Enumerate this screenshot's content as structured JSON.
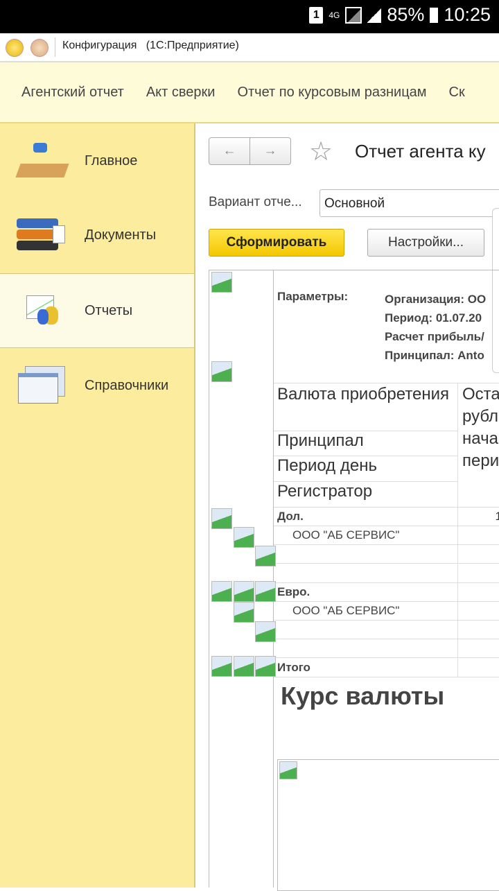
{
  "status_bar": {
    "sim": "1",
    "network": "4G",
    "battery": "85%",
    "time": "10:25"
  },
  "title_bar": {
    "title": "Конфигурация   (1С:Предприятие)"
  },
  "top_menu": [
    "Агентский отчет",
    "Акт сверки",
    "Отчет по курсовым разницам",
    "Ск"
  ],
  "sidebar": {
    "items": [
      {
        "label": "Главное"
      },
      {
        "label": "Документы"
      },
      {
        "label": "Отчеты"
      },
      {
        "label": "Справочники"
      }
    ]
  },
  "form": {
    "title": "Отчет агента ку",
    "variant_label": "Вариант отче...",
    "variant_value": "Основной",
    "generate": "Сформировать",
    "settings": "Настройки..."
  },
  "report": {
    "params_label": "Параметры:",
    "params": [
      "Организация: ОО",
      "Период: 01.07.20",
      "Расчет прибыль/",
      "Принципал: Anto"
    ],
    "headers_col1": [
      "Валюта приобретения",
      "Принципал",
      "Период день",
      "Регистратор"
    ],
    "header_col2": [
      "Оста",
      "рубл",
      "нача",
      "пери"
    ],
    "rows": [
      {
        "label": "Дол.",
        "bold": true,
        "value": "1"
      },
      {
        "label": "ООО \"АБ СЕРВИС\"",
        "bold": false,
        "value": ""
      },
      {
        "label": "",
        "bold": false,
        "value": ""
      },
      {
        "label": "",
        "bold": false,
        "value": ""
      },
      {
        "label": "Евро.",
        "bold": true,
        "value": ""
      },
      {
        "label": "ООО \"АБ СЕРВИС\"",
        "bold": false,
        "value": ""
      },
      {
        "label": "",
        "bold": false,
        "value": ""
      },
      {
        "label": "",
        "bold": false,
        "value": ""
      },
      {
        "label": "Итого",
        "bold": true,
        "value": ""
      }
    ],
    "section_title": "Курс валюты"
  }
}
